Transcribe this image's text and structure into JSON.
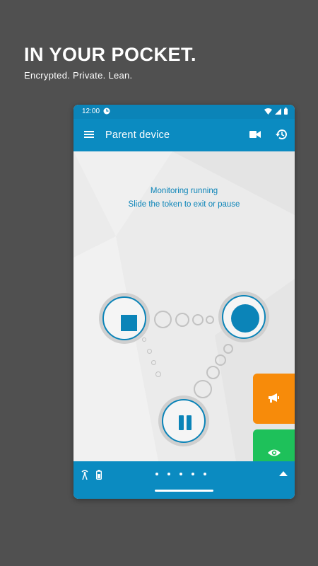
{
  "promo": {
    "headline": "IN YOUR POCKET.",
    "tagline": "Encrypted. Private. Lean."
  },
  "statusbar": {
    "time": "12:00",
    "icons": [
      "clock-icon",
      "wifi-icon",
      "signal-icon",
      "battery-icon"
    ]
  },
  "appbar": {
    "title": "Parent device",
    "icons": [
      "menu-icon",
      "video-camera-icon",
      "history-icon"
    ]
  },
  "monitor": {
    "status_line1": "Monitoring running",
    "status_line2": "Slide the token to exit or pause",
    "controls": [
      "stop-icon",
      "record-token",
      "pause-icon"
    ]
  },
  "side_actions": {
    "announce_icon": "megaphone-icon",
    "announce_color": "#f78b0a",
    "watch_icon": "eye-icon",
    "watch_color": "#1ec15a"
  },
  "bottombar": {
    "icons": [
      "antenna-icon",
      "battery-icon",
      "chevron-up-icon"
    ],
    "page_dots": 5
  },
  "colors": {
    "primary": "#0b8bc1",
    "background": "#505050"
  }
}
